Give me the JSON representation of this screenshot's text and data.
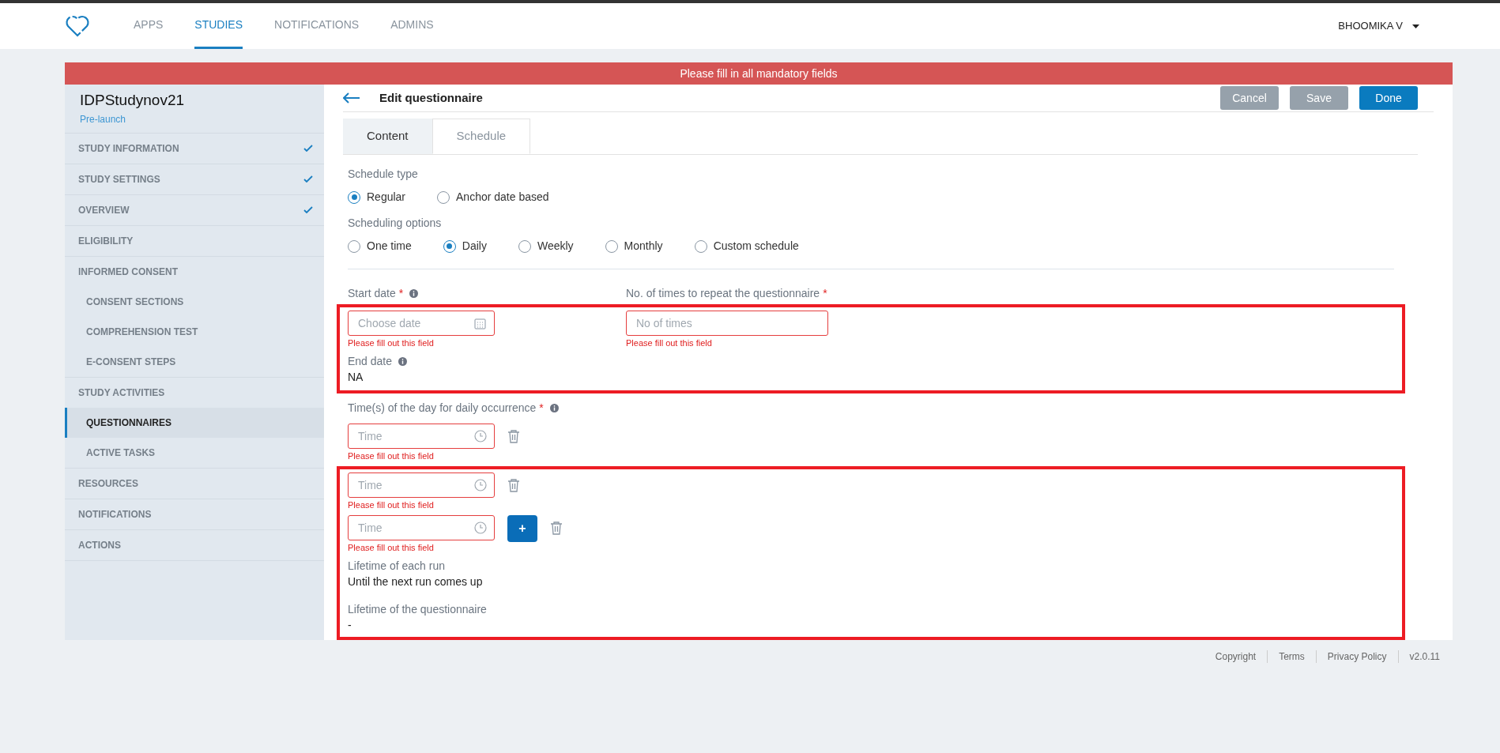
{
  "header": {
    "nav": [
      {
        "label": "APPS",
        "selected": false
      },
      {
        "label": "STUDIES",
        "selected": true
      },
      {
        "label": "NOTIFICATIONS",
        "selected": false
      },
      {
        "label": "ADMINS",
        "selected": false
      }
    ],
    "user": "BHOOMIKA V"
  },
  "banner": "Please fill in all mandatory fields",
  "sidebar": {
    "study_name": "IDPStudynov21",
    "status": "Pre-launch",
    "items": [
      {
        "label": "STUDY INFORMATION",
        "completed": true,
        "selected": false
      },
      {
        "label": "STUDY SETTINGS",
        "completed": true,
        "selected": false
      },
      {
        "label": "OVERVIEW",
        "completed": true,
        "selected": false
      },
      {
        "label": "ELIGIBILITY",
        "completed": false,
        "selected": false
      },
      {
        "label": "INFORMED CONSENT",
        "completed": false,
        "selected": false,
        "children": [
          {
            "label": "CONSENT SECTIONS",
            "selected": false
          },
          {
            "label": "COMPREHENSION TEST",
            "selected": false
          },
          {
            "label": "E-CONSENT STEPS",
            "selected": false
          }
        ]
      },
      {
        "label": "STUDY ACTIVITIES",
        "completed": false,
        "selected": false,
        "children": [
          {
            "label": "QUESTIONNAIRES",
            "selected": true
          },
          {
            "label": "ACTIVE TASKS",
            "selected": false
          }
        ]
      },
      {
        "label": "RESOURCES",
        "completed": false,
        "selected": false
      },
      {
        "label": "NOTIFICATIONS",
        "completed": false,
        "selected": false
      },
      {
        "label": "ACTIONS",
        "completed": false,
        "selected": false
      }
    ]
  },
  "editor": {
    "title": "Edit questionnaire",
    "buttons": [
      {
        "label": "Cancel",
        "kind": "secondary"
      },
      {
        "label": "Save",
        "kind": "secondary"
      },
      {
        "label": "Done",
        "kind": "primary"
      }
    ],
    "tabs": [
      {
        "label": "Content",
        "selected": false
      },
      {
        "label": "Schedule",
        "selected": true
      }
    ]
  },
  "schedule_type": {
    "label": "Schedule type",
    "options": [
      {
        "label": "Regular",
        "selected": true
      },
      {
        "label": "Anchor date based",
        "selected": false
      }
    ]
  },
  "scheduling_options": {
    "label": "Scheduling options",
    "options": [
      {
        "label": "One time",
        "selected": false
      },
      {
        "label": "Daily",
        "selected": true
      },
      {
        "label": "Weekly",
        "selected": false
      },
      {
        "label": "Monthly",
        "selected": false
      },
      {
        "label": "Custom schedule",
        "selected": false
      }
    ]
  },
  "date_section": {
    "highlighted": true,
    "start_date": {
      "label": "Start date",
      "required_mark": "*",
      "info": true,
      "placeholder": "Choose date",
      "error": "Please fill out this field"
    },
    "repeat": {
      "label": "No. of times to repeat the questionnaire",
      "required_mark": "*",
      "info": false,
      "placeholder": "No of times",
      "error": "Please fill out this field"
    },
    "end_date": {
      "label": "End date",
      "info": true,
      "value": "NA"
    }
  },
  "times": {
    "label": "Time(s) of the day for daily occurrence",
    "required_mark": "*",
    "info": true,
    "rows": [
      {
        "placeholder": "Time",
        "error": "Please fill out this field"
      }
    ]
  },
  "marked_region": {
    "highlighted": true,
    "time_rows": [
      {
        "placeholder": "Time",
        "error": "Please fill out this field"
      },
      {
        "placeholder": "Time",
        "error": "Please fill out this field",
        "add_button": "+"
      }
    ],
    "each_run": {
      "label": "Lifetime of each run",
      "value": "Until the next run comes up"
    },
    "questionnaire": {
      "label": "Lifetime of the questionnaire",
      "value": "-"
    }
  },
  "footer": [
    "Copyright",
    "Terms",
    "Privacy Policy",
    "v2.0.11"
  ]
}
